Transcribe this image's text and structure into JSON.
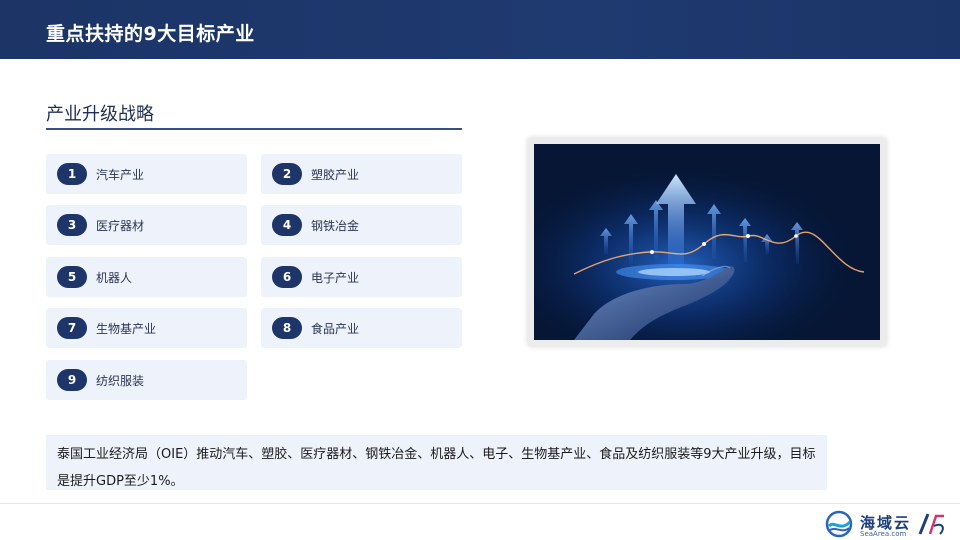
{
  "header": {
    "title": "重点扶持的9大目标产业"
  },
  "section": {
    "title": "产业升级战略"
  },
  "industries": [
    {
      "number": "1",
      "label": "汽车产业"
    },
    {
      "number": "2",
      "label": "塑胶产业"
    },
    {
      "number": "3",
      "label": "医疗器材"
    },
    {
      "number": "4",
      "label": "钢铁冶金"
    },
    {
      "number": "5",
      "label": "机器人"
    },
    {
      "number": "6",
      "label": "电子产业"
    },
    {
      "number": "7",
      "label": "生物基产业"
    },
    {
      "number": "8",
      "label": "食品产业"
    },
    {
      "number": "9",
      "label": "纺织服装"
    }
  ],
  "description": "泰国工业经济局（OIE）推动汽车、塑胶、医疗器材、钢铁冶金、机器人、电子、生物基产业、食品及纺织服装等9大产业升级，目标是提升GDP至少1%。",
  "footer": {
    "logo_name": "海域云",
    "logo_url": "SeaArea.com"
  },
  "colors": {
    "primary": "#1d3568",
    "card_bg": "#eef3fb",
    "accent": "#2f7fff"
  }
}
